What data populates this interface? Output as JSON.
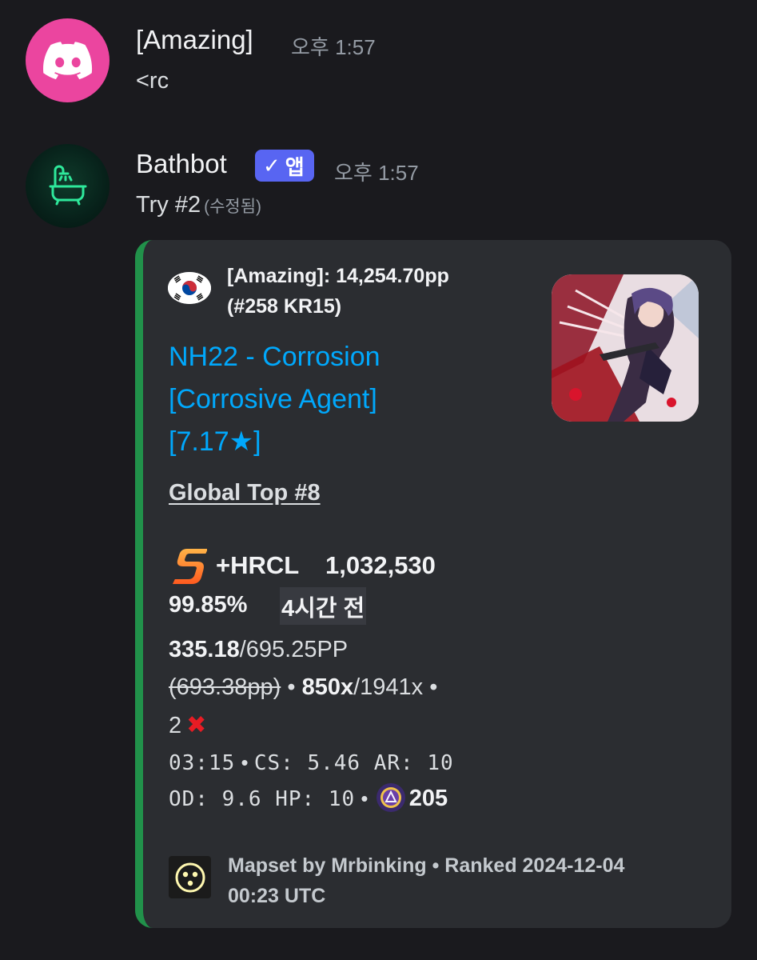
{
  "messages": [
    {
      "username": "[Amazing]",
      "timestamp": "오후 1:57",
      "content": "<rc"
    },
    {
      "username": "Bathbot",
      "badge": "앱",
      "timestamp": "오후 1:57",
      "content": "Try #2",
      "edited": "(수정됨)"
    }
  ],
  "embed": {
    "accent_color": "#21914a",
    "author_line1": "[Amazing]: 14,254.70pp",
    "author_line2": "(#258 KR15)",
    "title_line1": "NH22 - Corrosion",
    "title_line2": "[Corrosive Agent]",
    "title_line3": "[7.17★]",
    "global_top": "Global Top #8",
    "grade": "S",
    "mods": "+HRCL",
    "score": "1,032,530",
    "accuracy": "99.85%",
    "time_ago": "4시간 전",
    "pp_current": "335.18",
    "pp_max": "/695.25PP",
    "pp_fc": "(693.38pp)",
    "combo": "850x",
    "max_combo": "/1941x",
    "misses": "2",
    "miss_icon": "✖",
    "length": "03:15",
    "cs": "CS: 5.46",
    "ar": "AR: 10",
    "od": "OD: 9.6",
    "hp": "HP: 10",
    "bpm": "205",
    "footer_line1": "Mapset by Mrbinking • Ranked 2024-12-04",
    "footer_line2": "00:23 UTC"
  },
  "icons": {
    "discord_avatar": "discord-logo-icon",
    "bathbot_avatar": "bathtub-icon",
    "author": "korea-flag-icon",
    "footer": "osu-mapper-icon",
    "bpm": "osu-bpm-icon"
  }
}
